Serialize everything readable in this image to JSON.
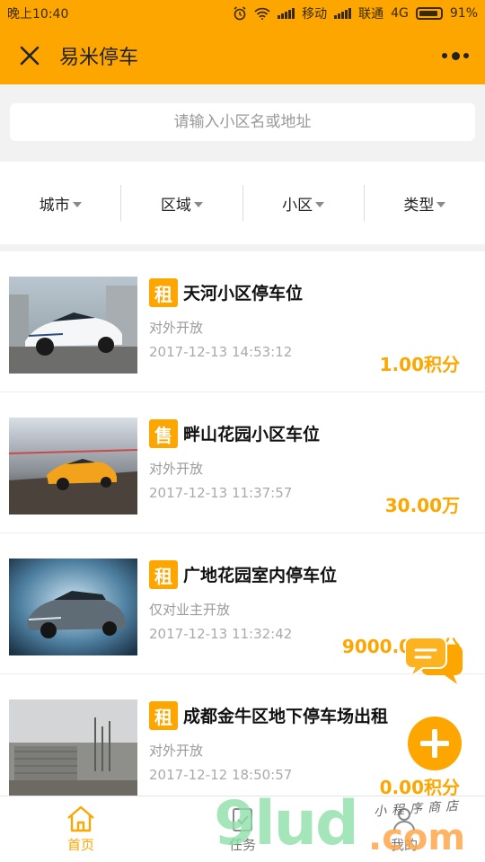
{
  "status_bar": {
    "time": "晚上10:40",
    "carrier1": "移动",
    "carrier2": "联通",
    "network": "4G",
    "battery": "91%"
  },
  "title_bar": {
    "title": "易米停车"
  },
  "search": {
    "placeholder": "请输入小区名或地址"
  },
  "filters": [
    {
      "label": "城市"
    },
    {
      "label": "区域"
    },
    {
      "label": "小区"
    },
    {
      "label": "类型"
    }
  ],
  "listings": [
    {
      "tag": "租",
      "title": "天河小区停车位",
      "access": "对外开放",
      "date": "2017-12-13 14:53:12",
      "price": "1.00积分"
    },
    {
      "tag": "售",
      "title": "畔山花园小区车位",
      "access": "对外开放",
      "date": "2017-12-13 11:37:57",
      "price": "30.00万"
    },
    {
      "tag": "租",
      "title": "广地花园室内停车位",
      "access": "仅对业主开放",
      "date": "2017-12-13 11:32:42",
      "price": "9000.00积分"
    },
    {
      "tag": "租",
      "title": "成都金牛区地下停车场出租",
      "access": "对外开放",
      "date": "2017-12-12 18:50:57",
      "price": "0.00积分"
    }
  ],
  "bottom_nav": [
    {
      "label": "首页",
      "icon": "home-icon",
      "active": true
    },
    {
      "label": "任务",
      "icon": "task-icon",
      "active": false
    },
    {
      "label": "我的",
      "icon": "user-icon",
      "active": false
    }
  ],
  "watermark": {
    "main": "9lud",
    "domain": ".com",
    "small": "小程序商店"
  },
  "colors": {
    "accent": "#fda600",
    "background": "#f2f2f2"
  }
}
